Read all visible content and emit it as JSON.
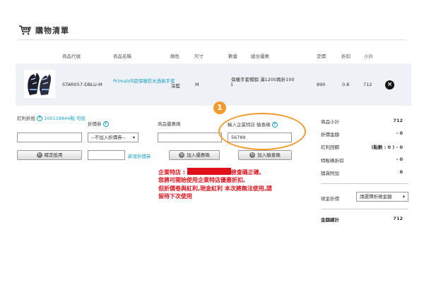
{
  "header": {
    "title": "購物清單",
    "cart_icon": "shopping-cart-icon"
  },
  "table": {
    "headers": [
      "商品代號",
      "商品名稱",
      "顏色",
      "尺寸",
      "數量",
      "組合優惠",
      "定價",
      "折扣",
      "小計"
    ],
    "row": {
      "code": "STAR057-DBLU-M",
      "name": "Primaloft超保暖防水透氣手套",
      "color": "深藍",
      "size": "M",
      "qty": "1",
      "promo": "保暖手套暢銷 滿1200再折100",
      "price": "890",
      "discount": "0.8",
      "subtotal": "712"
    }
  },
  "bonus": {
    "label": "紅利折抵",
    "points": "100118844點 可抵"
  },
  "coupon": {
    "label": "折價券",
    "select": "--不加入折價券--",
    "add_link": "新增折價券"
  },
  "promo_code": {
    "label": "商品優惠碼",
    "button": "加入優惠碼"
  },
  "corp_code": {
    "label": "輸入企業特店 驗查碼",
    "value": "56789",
    "button": "加入驗查碼"
  },
  "buttons": {
    "confirm": "確定抵用"
  },
  "callout": {
    "number": "1"
  },
  "message": {
    "line1_pre": "企業特店 : ",
    "line1_post": "檢查碼正確,",
    "line2": "您將可開始使用企業特店優惠折扣,",
    "line3": "但折價卷與紅利,現金紅利 本次將無法使用,請",
    "line4": "留待下次使用"
  },
  "summary": {
    "rows": [
      {
        "label": "商品小計",
        "value": "712"
      },
      {
        "label": "折價金額",
        "value": "- 0"
      },
      {
        "label": "紅利回饋",
        "value": "(點數 : 0 ) - 0"
      },
      {
        "label": "特販碼折扣",
        "value": "- 0"
      },
      {
        "label": "隨貨附加",
        "value": "0"
      }
    ],
    "cash_label": "現金折價",
    "cash_select": "請選擇折現金額",
    "total_label": "金額總計",
    "total_value": "712"
  },
  "colors": {
    "accent": "#1aa0c5",
    "callout": "#f29a2e",
    "alert": "#e0101a"
  }
}
